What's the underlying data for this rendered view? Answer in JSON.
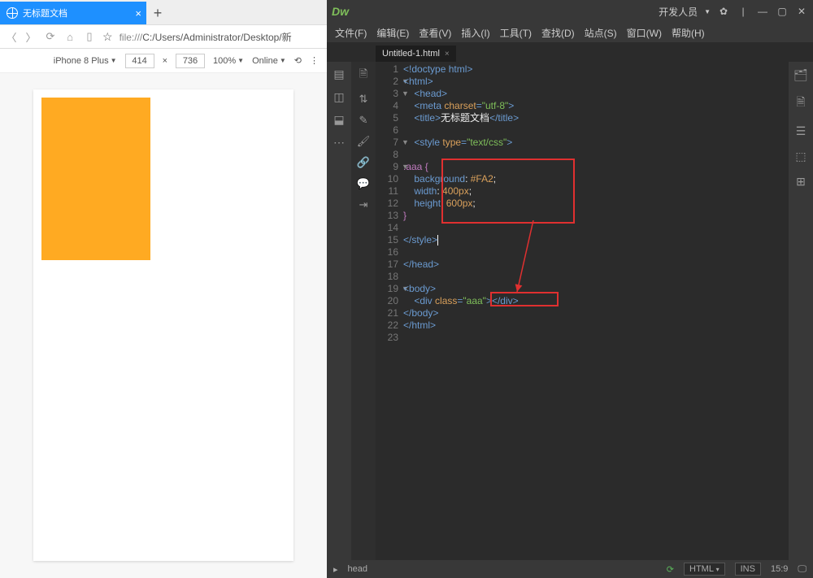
{
  "browser": {
    "tab_title": "无标题文档",
    "url_prefix": "file:///",
    "url_path": "C:/Users/Administrator/Desktop/新",
    "device": "iPhone 8 Plus",
    "width": "414",
    "height": "736",
    "zoom": "100%",
    "online": "Online"
  },
  "dw": {
    "app_role": "开发人员",
    "menus": [
      "文件(F)",
      "编辑(E)",
      "查看(V)",
      "插入(I)",
      "工具(T)",
      "查找(D)",
      "站点(S)",
      "窗口(W)",
      "帮助(H)"
    ],
    "file_tab": "Untitled-1.html",
    "status": {
      "breadcrumb": "head",
      "lang": "HTML",
      "ins": "INS",
      "cursor": "15:9"
    }
  },
  "code": {
    "l1": "<!doctype html>",
    "l2": "<html>",
    "l3a": "    <",
    "l3b": "head",
    "l3c": ">",
    "l4a": "    <",
    "l4b": "meta ",
    "l4c": "charset",
    "l4d": "=",
    "l4e": "\"utf-8\"",
    "l4f": ">",
    "l5a": "    <",
    "l5b": "title",
    "l5c": ">",
    "l5d": "无标题文档",
    "l5e": "</",
    "l5f": "title",
    "l5g": ">",
    "l7a": "    <",
    "l7b": "style ",
    "l7c": "type",
    "l7d": "=",
    "l7e": "\"text/css\"",
    "l7f": ">",
    "l9": ".aaa {",
    "l10a": "    ",
    "l10b": "background",
    "l10c": ": ",
    "l10d": "#FA2",
    "l10e": ";",
    "l11a": "    ",
    "l11b": "width",
    "l11c": ": ",
    "l11d": "400px",
    "l11e": ";",
    "l12a": "    ",
    "l12b": "height",
    "l12c": ": ",
    "l12d": "600px",
    "l12e": ";",
    "l13": "}",
    "l15a": "</",
    "l15b": "style",
    "l15c": ">",
    "l17a": "</",
    "l17b": "head",
    "l17c": ">",
    "l19a": "<",
    "l19b": "body",
    "l19c": ">",
    "l20a": "    <",
    "l20b": "div ",
    "l20c": "class",
    "l20d": "=",
    "l20e": "\"aaa\"",
    "l20f": "></",
    "l20g": "div",
    "l20h": ">",
    "l21a": "</",
    "l21b": "body",
    "l21c": ">",
    "l22a": "</",
    "l22b": "html",
    "l22c": ">"
  },
  "line_numbers": [
    "1",
    "2",
    "3",
    "4",
    "5",
    "6",
    "7",
    "8",
    "9",
    "10",
    "11",
    "12",
    "13",
    "14",
    "15",
    "16",
    "17",
    "18",
    "19",
    "20",
    "21",
    "22",
    "23"
  ]
}
